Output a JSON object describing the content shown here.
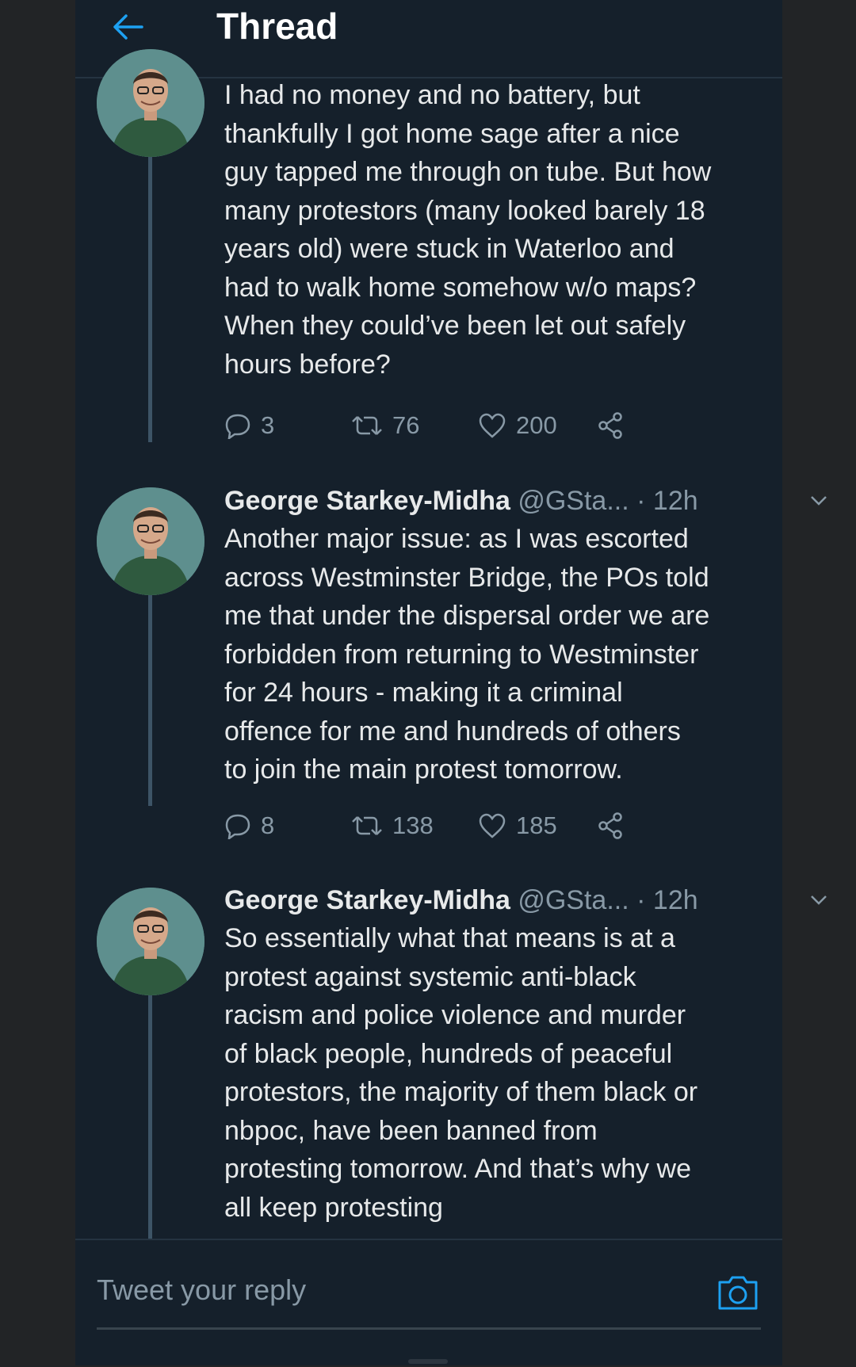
{
  "header": {
    "title": "Thread",
    "back_icon": "arrow-left-icon"
  },
  "colors": {
    "background": "#15202b",
    "accent": "#1da1f2",
    "muted": "#8899a6",
    "text": "#e7e9ea"
  },
  "tweets": [
    {
      "text": "I had no money and no battery, but\nthankfully I got home sage after a nice\nguy tapped me through on tube. But how\nmany protestors (many looked barely 18\nyears old) were stuck in Waterloo and\nhad to walk home somehow w/o maps?\nWhen they could’ve been let out safely\nhours before?",
      "replies": "3",
      "retweets": "76",
      "likes": "200"
    },
    {
      "name": "George Starkey-Midha",
      "handle": "@GSta...",
      "time": "· 12h",
      "text": "Another major issue: as I was escorted\nacross Westminster Bridge, the POs told\nme that under the dispersal order we are\nforbidden from returning to Westminster\nfor 24 hours - making it a criminal\noffence for me and hundreds of others\nto join the main protest tomorrow.",
      "replies": "8",
      "retweets": "138",
      "likes": "185"
    },
    {
      "name": "George Starkey-Midha",
      "handle": "@GSta...",
      "time": "· 12h",
      "text": "So essentially what that means is at a\nprotest against systemic anti-black\nracism and police violence and murder\nof black people, hundreds of peaceful\nprotestors, the majority of them black or\nnbpoc, have been banned from\nprotesting tomorrow. And that’s why we\nall keep protesting"
    }
  ],
  "reply": {
    "placeholder": "Tweet your reply",
    "camera_icon": "camera-icon"
  }
}
